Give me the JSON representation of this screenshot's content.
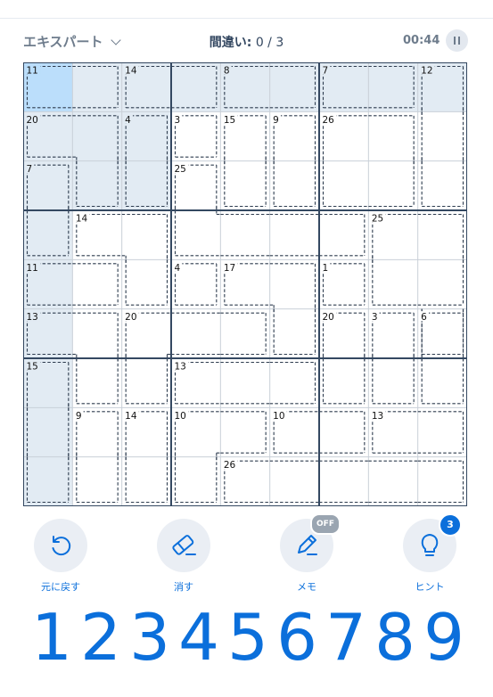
{
  "header": {
    "difficulty": "エキスパート",
    "mistakes_label": "間違い:",
    "mistakes_value": "0 / 3",
    "timer": "00:44"
  },
  "colors": {
    "selected": "#bbdefb",
    "highlight": "#e2ebf3",
    "grid_thin": "#c9d0d8",
    "grid_thick": "#344861",
    "accent": "#0b6fdb"
  },
  "board": {
    "selected_cell": [
      0,
      0
    ],
    "highlighted_cells": [
      [
        0,
        1
      ],
      [
        0,
        2
      ],
      [
        0,
        3
      ],
      [
        0,
        4
      ],
      [
        0,
        5
      ],
      [
        0,
        6
      ],
      [
        0,
        7
      ],
      [
        0,
        8
      ],
      [
        1,
        0
      ],
      [
        1,
        1
      ],
      [
        1,
        2
      ],
      [
        2,
        0
      ],
      [
        2,
        1
      ],
      [
        2,
        2
      ],
      [
        3,
        0
      ],
      [
        4,
        0
      ],
      [
        5,
        0
      ],
      [
        6,
        0
      ],
      [
        7,
        0
      ],
      [
        8,
        0
      ]
    ],
    "cages": [
      {
        "sum": "11",
        "cells": [
          [
            0,
            0
          ],
          [
            0,
            1
          ]
        ]
      },
      {
        "sum": "14",
        "cells": [
          [
            0,
            2
          ],
          [
            0,
            3
          ]
        ]
      },
      {
        "sum": "8",
        "cells": [
          [
            0,
            4
          ],
          [
            0,
            5
          ]
        ]
      },
      {
        "sum": "7",
        "cells": [
          [
            0,
            6
          ],
          [
            0,
            7
          ]
        ]
      },
      {
        "sum": "12",
        "cells": [
          [
            0,
            8
          ],
          [
            1,
            8
          ],
          [
            2,
            8
          ]
        ]
      },
      {
        "sum": "20",
        "cells": [
          [
            1,
            0
          ],
          [
            1,
            1
          ],
          [
            2,
            1
          ]
        ]
      },
      {
        "sum": "4",
        "cells": [
          [
            1,
            2
          ],
          [
            2,
            2
          ]
        ]
      },
      {
        "sum": "3",
        "cells": [
          [
            1,
            3
          ]
        ]
      },
      {
        "sum": "15",
        "cells": [
          [
            1,
            4
          ],
          [
            2,
            4
          ]
        ]
      },
      {
        "sum": "9",
        "cells": [
          [
            1,
            5
          ],
          [
            2,
            5
          ]
        ]
      },
      {
        "sum": "26",
        "cells": [
          [
            1,
            6
          ],
          [
            1,
            7
          ],
          [
            2,
            6
          ],
          [
            2,
            7
          ]
        ]
      },
      {
        "sum": "7",
        "cells": [
          [
            2,
            0
          ],
          [
            3,
            0
          ]
        ]
      },
      {
        "sum": "25",
        "cells": [
          [
            2,
            3
          ],
          [
            3,
            3
          ],
          [
            3,
            4
          ],
          [
            3,
            5
          ],
          [
            3,
            6
          ]
        ]
      },
      {
        "sum": "14",
        "cells": [
          [
            3,
            1
          ],
          [
            3,
            2
          ],
          [
            4,
            2
          ]
        ]
      },
      {
        "sum": "25",
        "cells": [
          [
            3,
            7
          ],
          [
            3,
            8
          ],
          [
            4,
            7
          ],
          [
            4,
            8
          ],
          [
            5,
            8
          ]
        ]
      },
      {
        "sum": "11",
        "cells": [
          [
            4,
            0
          ],
          [
            4,
            1
          ]
        ]
      },
      {
        "sum": "4",
        "cells": [
          [
            4,
            3
          ]
        ]
      },
      {
        "sum": "17",
        "cells": [
          [
            4,
            4
          ],
          [
            4,
            5
          ],
          [
            5,
            5
          ]
        ]
      },
      {
        "sum": "1",
        "cells": [
          [
            4,
            6
          ]
        ]
      },
      {
        "sum": "13",
        "cells": [
          [
            5,
            0
          ],
          [
            5,
            1
          ],
          [
            6,
            1
          ]
        ]
      },
      {
        "sum": "20",
        "cells": [
          [
            5,
            2
          ],
          [
            5,
            3
          ],
          [
            5,
            4
          ],
          [
            6,
            2
          ]
        ]
      },
      {
        "sum": "20",
        "cells": [
          [
            5,
            6
          ],
          [
            6,
            6
          ]
        ]
      },
      {
        "sum": "3",
        "cells": [
          [
            5,
            7
          ],
          [
            6,
            7
          ]
        ]
      },
      {
        "sum": "6",
        "cells": [
          [
            5,
            8
          ],
          [
            6,
            8
          ]
        ]
      },
      {
        "sum": "15",
        "cells": [
          [
            6,
            0
          ],
          [
            7,
            0
          ],
          [
            8,
            0
          ]
        ]
      },
      {
        "sum": "13",
        "cells": [
          [
            6,
            3
          ],
          [
            6,
            4
          ],
          [
            6,
            5
          ]
        ]
      },
      {
        "sum": "9",
        "cells": [
          [
            7,
            1
          ],
          [
            8,
            1
          ]
        ]
      },
      {
        "sum": "14",
        "cells": [
          [
            7,
            2
          ],
          [
            8,
            2
          ]
        ]
      },
      {
        "sum": "10",
        "cells": [
          [
            7,
            3
          ],
          [
            7,
            4
          ],
          [
            8,
            3
          ]
        ]
      },
      {
        "sum": "10",
        "cells": [
          [
            7,
            5
          ],
          [
            7,
            6
          ]
        ]
      },
      {
        "sum": "13",
        "cells": [
          [
            7,
            7
          ],
          [
            7,
            8
          ]
        ]
      },
      {
        "sum": "26",
        "cells": [
          [
            8,
            4
          ],
          [
            8,
            5
          ],
          [
            8,
            6
          ],
          [
            8,
            7
          ],
          [
            8,
            8
          ]
        ]
      }
    ]
  },
  "controls": {
    "undo": {
      "label": "元に戻す",
      "icon": "undo-icon"
    },
    "erase": {
      "label": "消す",
      "icon": "eraser-icon"
    },
    "notes": {
      "label": "メモ",
      "icon": "pencil-icon",
      "badge": "OFF"
    },
    "hint": {
      "label": "ヒント",
      "icon": "lightbulb-icon",
      "badge": "3"
    }
  },
  "numpad": [
    "1",
    "2",
    "3",
    "4",
    "5",
    "6",
    "7",
    "8",
    "9"
  ]
}
